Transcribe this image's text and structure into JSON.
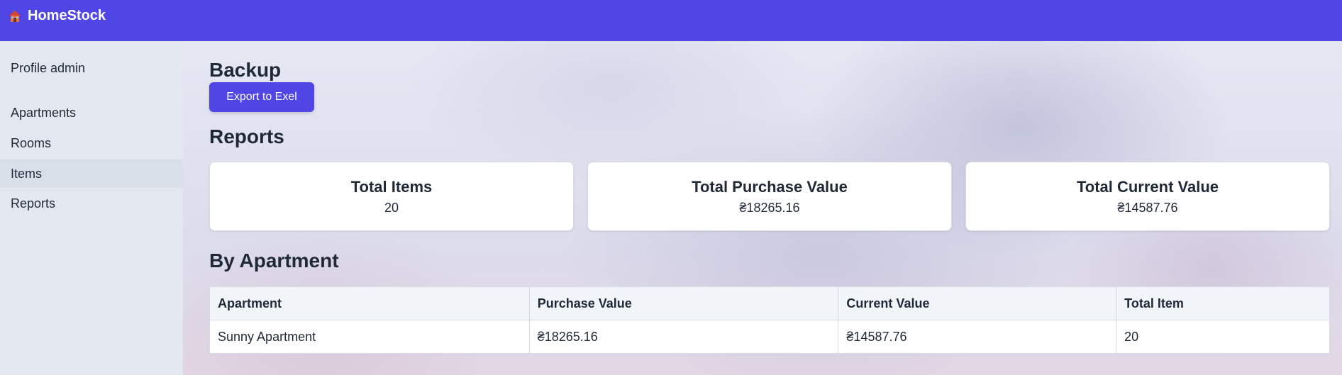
{
  "app": {
    "name": "HomeStock",
    "logo_icon": "house-icon"
  },
  "sidebar": {
    "profile": "Profile admin",
    "items": [
      {
        "label": "Apartments"
      },
      {
        "label": "Rooms"
      },
      {
        "label": "Items",
        "active": true
      },
      {
        "label": "Reports"
      }
    ]
  },
  "backup": {
    "heading": "Backup",
    "export_label": "Export to Exel"
  },
  "reports": {
    "heading": "Reports",
    "cards": [
      {
        "title": "Total Items",
        "value": "20"
      },
      {
        "title": "Total Purchase Value",
        "value": "₴18265.16"
      },
      {
        "title": "Total Current Value",
        "value": "₴14587.76"
      }
    ]
  },
  "by_apartment": {
    "heading": "By Apartment",
    "columns": [
      "Apartment",
      "Purchase Value",
      "Current Value",
      "Total Item"
    ],
    "rows": [
      [
        "Sunny Apartment",
        "₴18265.16",
        "₴14587.76",
        "20"
      ]
    ]
  },
  "colors": {
    "primary": "#5046e5",
    "sidebar_bg": "#e2e7f0",
    "text": "#1f2937"
  }
}
